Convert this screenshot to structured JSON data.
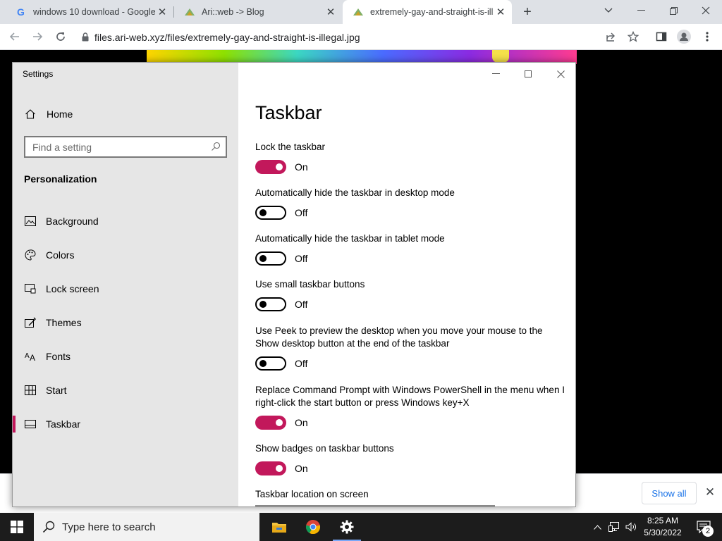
{
  "browser": {
    "tabs": [
      {
        "title": "windows 10 download - Google",
        "icon": "google-g-icon",
        "active": false
      },
      {
        "title": "Ari::web -> Blog",
        "icon": "ari-web-favicon",
        "active": false
      },
      {
        "title": "extremely-gay-and-straight-is-ill",
        "icon": "ari-web-favicon",
        "active": true
      }
    ],
    "new_tab_label": "+",
    "url": "files.ari-web.xyz/files/extremely-gay-and-straight-is-illegal.jpg"
  },
  "download_bar": {
    "show_all_label": "Show all"
  },
  "settings": {
    "window_title": "Settings",
    "home_label": "Home",
    "search_placeholder": "Find a setting",
    "category": "Personalization",
    "nav_items": [
      {
        "label": "Background",
        "icon": "background-icon"
      },
      {
        "label": "Colors",
        "icon": "palette-icon"
      },
      {
        "label": "Lock screen",
        "icon": "lock-screen-icon"
      },
      {
        "label": "Themes",
        "icon": "themes-icon"
      },
      {
        "label": "Fonts",
        "icon": "fonts-icon"
      },
      {
        "label": "Start",
        "icon": "start-icon"
      },
      {
        "label": "Taskbar",
        "icon": "taskbar-icon",
        "selected": true
      }
    ],
    "page_title": "Taskbar",
    "options": [
      {
        "label": "Lock the taskbar",
        "on": true,
        "state": "On"
      },
      {
        "label": "Automatically hide the taskbar in desktop mode",
        "on": false,
        "state": "Off"
      },
      {
        "label": "Automatically hide the taskbar in tablet mode",
        "on": false,
        "state": "Off"
      },
      {
        "label": "Use small taskbar buttons",
        "on": false,
        "state": "Off"
      },
      {
        "label": "Use Peek to preview the desktop when you move your mouse to the Show desktop button at the end of the taskbar",
        "on": false,
        "state": "Off"
      },
      {
        "label": "Replace Command Prompt with Windows PowerShell in the menu when I right-click the start button or press Windows key+X",
        "on": true,
        "state": "On"
      },
      {
        "label": "Show badges on taskbar buttons",
        "on": true,
        "state": "On"
      }
    ],
    "location_label": "Taskbar location on screen",
    "accent_color": "#c2185b"
  },
  "taskbar": {
    "search_placeholder": "Type here to search",
    "apps": [
      "file-explorer-icon",
      "chrome-icon",
      "settings-gear-icon"
    ],
    "time": "8:25 AM",
    "date": "5/30/2022",
    "notification_count": "2"
  }
}
